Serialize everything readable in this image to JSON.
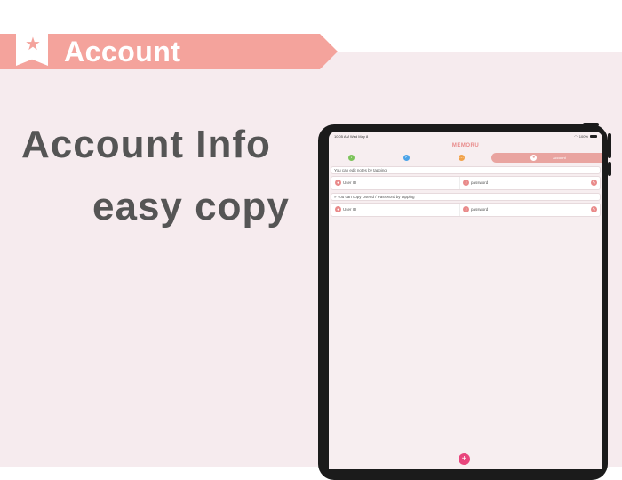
{
  "banner": {
    "title": "Account",
    "icon": "bookmark-star-icon"
  },
  "headline": {
    "line1": "Account Info",
    "line2": "easy copy"
  },
  "device": {
    "status_bar": {
      "time": "10:05 AM  Wed May 8",
      "battery": "100%"
    },
    "app_title": "MEMORU",
    "tabs": [
      {
        "icon": "download-icon",
        "color": "#7cc35a"
      },
      {
        "icon": "check-icon",
        "color": "#4aa3e8"
      },
      {
        "icon": "message-icon",
        "color": "#f1a24a"
      },
      {
        "icon": "user-icon",
        "label": "Account",
        "active": true
      }
    ],
    "sections": [
      {
        "note": "You can edit notes by tapping",
        "user_label": "User ID",
        "password_label": "password"
      },
      {
        "note": "» You can copy UserId / Password by tapping",
        "user_label": "User ID",
        "password_label": "password"
      }
    ],
    "add_button": "+"
  },
  "colors": {
    "accent": "#f4a39c",
    "background": "#f6ebee",
    "headline": "#555555",
    "fab": "#e8457c"
  }
}
